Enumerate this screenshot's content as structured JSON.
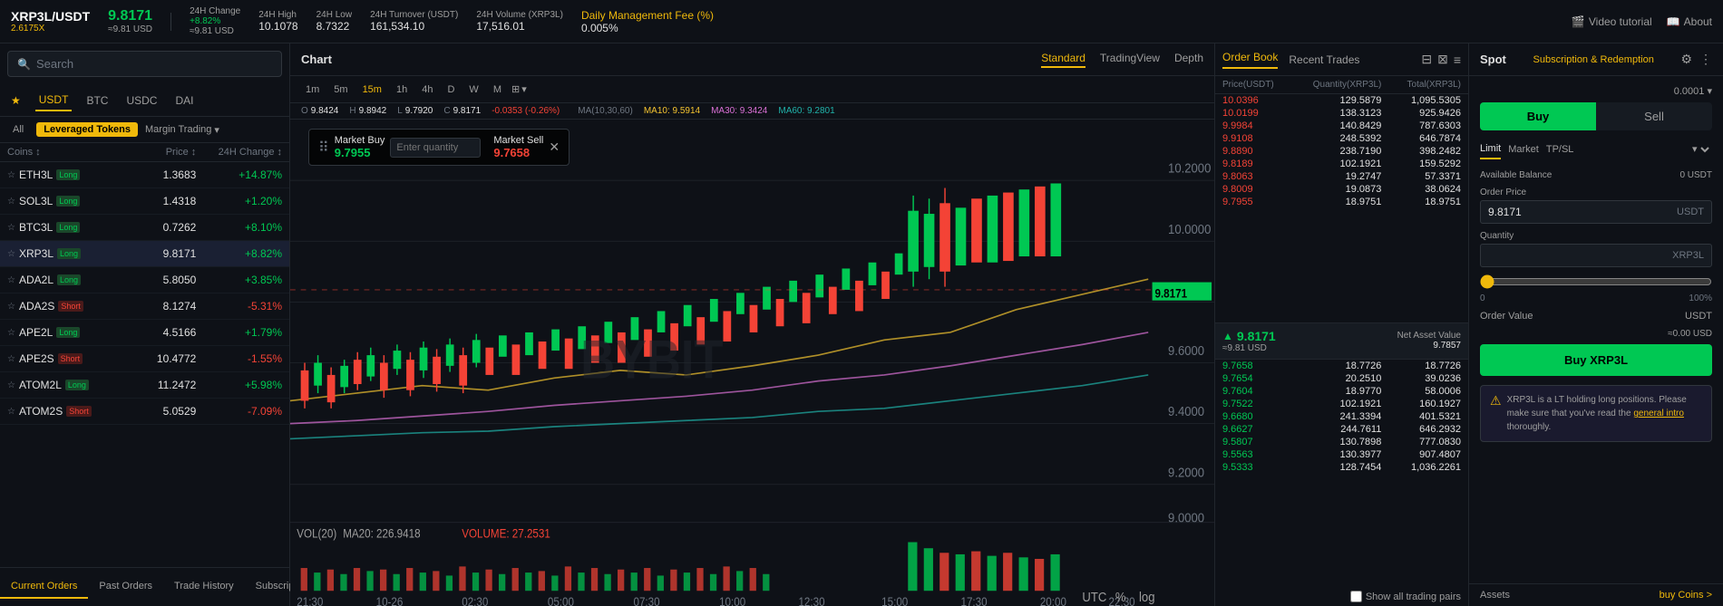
{
  "header": {
    "symbol": "XRP3L/USDT",
    "sub": "2.6175X",
    "price": "9.8171",
    "price_usd": "≈9.81 USD",
    "change_24h_label": "24H Change",
    "change_24h": "+8.82%",
    "change_abs": "≈9.81 USD",
    "high_24h_label": "24H High",
    "high_24h": "10.1078",
    "low_24h_label": "24H Low",
    "low_24h": "8.7322",
    "turnover_label": "24H Turnover (USDT)",
    "turnover": "161,534.10",
    "volume_label": "24H Volume (XRP3L)",
    "volume": "17,516.01",
    "mgmt_label": "Daily Management Fee (%)",
    "mgmt": "0.005%",
    "video_tutorial": "Video tutorial",
    "about": "About"
  },
  "sidebar": {
    "search_placeholder": "Search",
    "tabs": [
      {
        "label": "★",
        "key": "favorites"
      },
      {
        "label": "USDT",
        "key": "usdt",
        "active": true
      },
      {
        "label": "BTC",
        "key": "btc"
      },
      {
        "label": "USDC",
        "key": "usdc"
      },
      {
        "label": "DAI",
        "key": "dai"
      }
    ],
    "filters": [
      {
        "label": "All",
        "key": "all"
      },
      {
        "label": "Leveraged Tokens",
        "key": "leveraged",
        "active": true
      },
      {
        "label": "Margin Trading",
        "key": "margin"
      }
    ],
    "col_headers": [
      "Coins ↕",
      "Price ↕",
      "24H Change ↕"
    ],
    "coins": [
      {
        "symbol": "ETH3L",
        "badge": "Long",
        "type": "long",
        "price": "1.3683",
        "change": "+14.87%",
        "positive": true
      },
      {
        "symbol": "SOL3L",
        "badge": "Long",
        "type": "long",
        "price": "1.4318",
        "change": "+1.20%",
        "positive": true
      },
      {
        "symbol": "BTC3L",
        "badge": "Long",
        "type": "long",
        "price": "0.7262",
        "change": "+8.10%",
        "positive": true
      },
      {
        "symbol": "XRP3L",
        "badge": "Long",
        "type": "long",
        "price": "9.8171",
        "change": "+8.82%",
        "positive": true,
        "active": true
      },
      {
        "symbol": "ADA2L",
        "badge": "Long",
        "type": "long",
        "price": "5.8050",
        "change": "+3.85%",
        "positive": true
      },
      {
        "symbol": "ADA2S",
        "badge": "Short",
        "type": "short",
        "price": "8.1274",
        "change": "-5.31%",
        "positive": false
      },
      {
        "symbol": "APE2L",
        "badge": "Long",
        "type": "long",
        "price": "4.5166",
        "change": "+1.79%",
        "positive": true
      },
      {
        "symbol": "APE2S",
        "badge": "Short",
        "type": "short",
        "price": "10.4772",
        "change": "-1.55%",
        "positive": false
      },
      {
        "symbol": "ATOM2L",
        "badge": "Long",
        "type": "long",
        "price": "11.2472",
        "change": "+5.98%",
        "positive": true
      },
      {
        "symbol": "ATOM2S",
        "badge": "Short",
        "type": "short",
        "price": "5.0529",
        "change": "-7.09%",
        "positive": false
      }
    ],
    "bottom_tabs": [
      "Current Orders",
      "Past Orders",
      "Trade History",
      "Subscription & Redemption History"
    ]
  },
  "chart": {
    "title": "Chart",
    "view_tabs": [
      "Standard",
      "TradingView",
      "Depth"
    ],
    "active_view": "Standard",
    "time_frames": [
      "1m",
      "5m",
      "15m",
      "1h",
      "4h",
      "D",
      "W",
      "M"
    ],
    "active_tf": "15m",
    "ohlc": {
      "o": "9.8424",
      "h": "9.8942",
      "l": "9.7920",
      "c": "9.8171",
      "change": "-0.0353 (-0.26%)"
    },
    "ma_labels": [
      "MA(10,30,60)",
      "MA10: 9.5914",
      "MA30: 9.3424",
      "MA60: 9.2801"
    ],
    "vol_label": "VOL(20)",
    "vol_ma": "MA20: 226.9418",
    "vol_value": "VOLUME: 27.2531",
    "market_buy": {
      "label": "Market Buy",
      "price": "9.7955"
    },
    "market_sell": {
      "label": "Market Sell",
      "price": "9.7658"
    },
    "qty_placeholder": "Enter quantity",
    "utc_label": "UTC",
    "pct_label": "%",
    "log_label": "log"
  },
  "order_book": {
    "tabs": [
      "Order Book",
      "Recent Trades"
    ],
    "active_tab": "Order Book",
    "col_headers": [
      "Price(USDT)",
      "Quantity(XRP3L)",
      "Total(XRP3L)"
    ],
    "sell_orders": [
      {
        "price": "10.0396",
        "qty": "129.5879",
        "total": "1,095.5305"
      },
      {
        "price": "10.0199",
        "qty": "138.3123",
        "total": "925.9426"
      },
      {
        "price": "9.9984",
        "qty": "140.8429",
        "total": "787.6303"
      },
      {
        "price": "9.9108",
        "qty": "248.5392",
        "total": "646.7874"
      },
      {
        "price": "9.8890",
        "qty": "238.7190",
        "total": "398.2482"
      },
      {
        "price": "9.8189",
        "qty": "102.1921",
        "total": "159.5292"
      },
      {
        "price": "9.8063",
        "qty": "19.2747",
        "total": "57.3371"
      },
      {
        "price": "9.8009",
        "qty": "19.0873",
        "total": "38.0624"
      },
      {
        "price": "9.7955",
        "qty": "18.9751",
        "total": "18.9751"
      }
    ],
    "mid_price": "9.8171",
    "mid_price_usd": "≈9.81 USD",
    "net_asset_label": "Net Asset Value",
    "net_asset": "9.7857",
    "buy_orders": [
      {
        "price": "9.7658",
        "qty": "18.7726",
        "total": "18.7726"
      },
      {
        "price": "9.7654",
        "qty": "20.2510",
        "total": "39.0236"
      },
      {
        "price": "9.7604",
        "qty": "18.9770",
        "total": "58.0006"
      },
      {
        "price": "9.7522",
        "qty": "102.1921",
        "total": "160.1927"
      },
      {
        "price": "9.6680",
        "qty": "241.3394",
        "total": "401.5321"
      },
      {
        "price": "9.6627",
        "qty": "244.7611",
        "total": "646.2932"
      },
      {
        "price": "9.5807",
        "qty": "130.7898",
        "total": "777.0830"
      },
      {
        "price": "9.5563",
        "qty": "130.3977",
        "total": "907.4807"
      },
      {
        "price": "9.5333",
        "qty": "128.7454",
        "total": "1,036.2261"
      }
    ],
    "show_all_label": "Show all trading pairs"
  },
  "trading_panel": {
    "title": "Spot",
    "sub_link": "Subscription & Redemption",
    "buy_label": "Buy",
    "sell_label": "Sell",
    "order_types": [
      "Limit",
      "Market",
      "TP/SL"
    ],
    "active_order_type": "Limit",
    "balance_label": "Available Balance",
    "balance_value": "0 USDT",
    "order_price_label": "Order Price",
    "order_price_value": "9.8171",
    "order_price_unit": "USDT",
    "quantity_label": "Quantity",
    "quantity_unit": "XRP3L",
    "slider_min": "0",
    "slider_max": "100%",
    "order_value_label": "Order Value",
    "order_value": "≈0.00 USD",
    "order_value_unit": "USDT",
    "buy_xrp_btn": "Buy XRP3L",
    "warning_text": "XRP3L is a LT holding long positions. Please make sure that you've read the",
    "warning_link": "general intro",
    "warning_suffix": "thoroughly.",
    "assets_label": "Assets",
    "buy_coins_label": "buy Coins >"
  }
}
